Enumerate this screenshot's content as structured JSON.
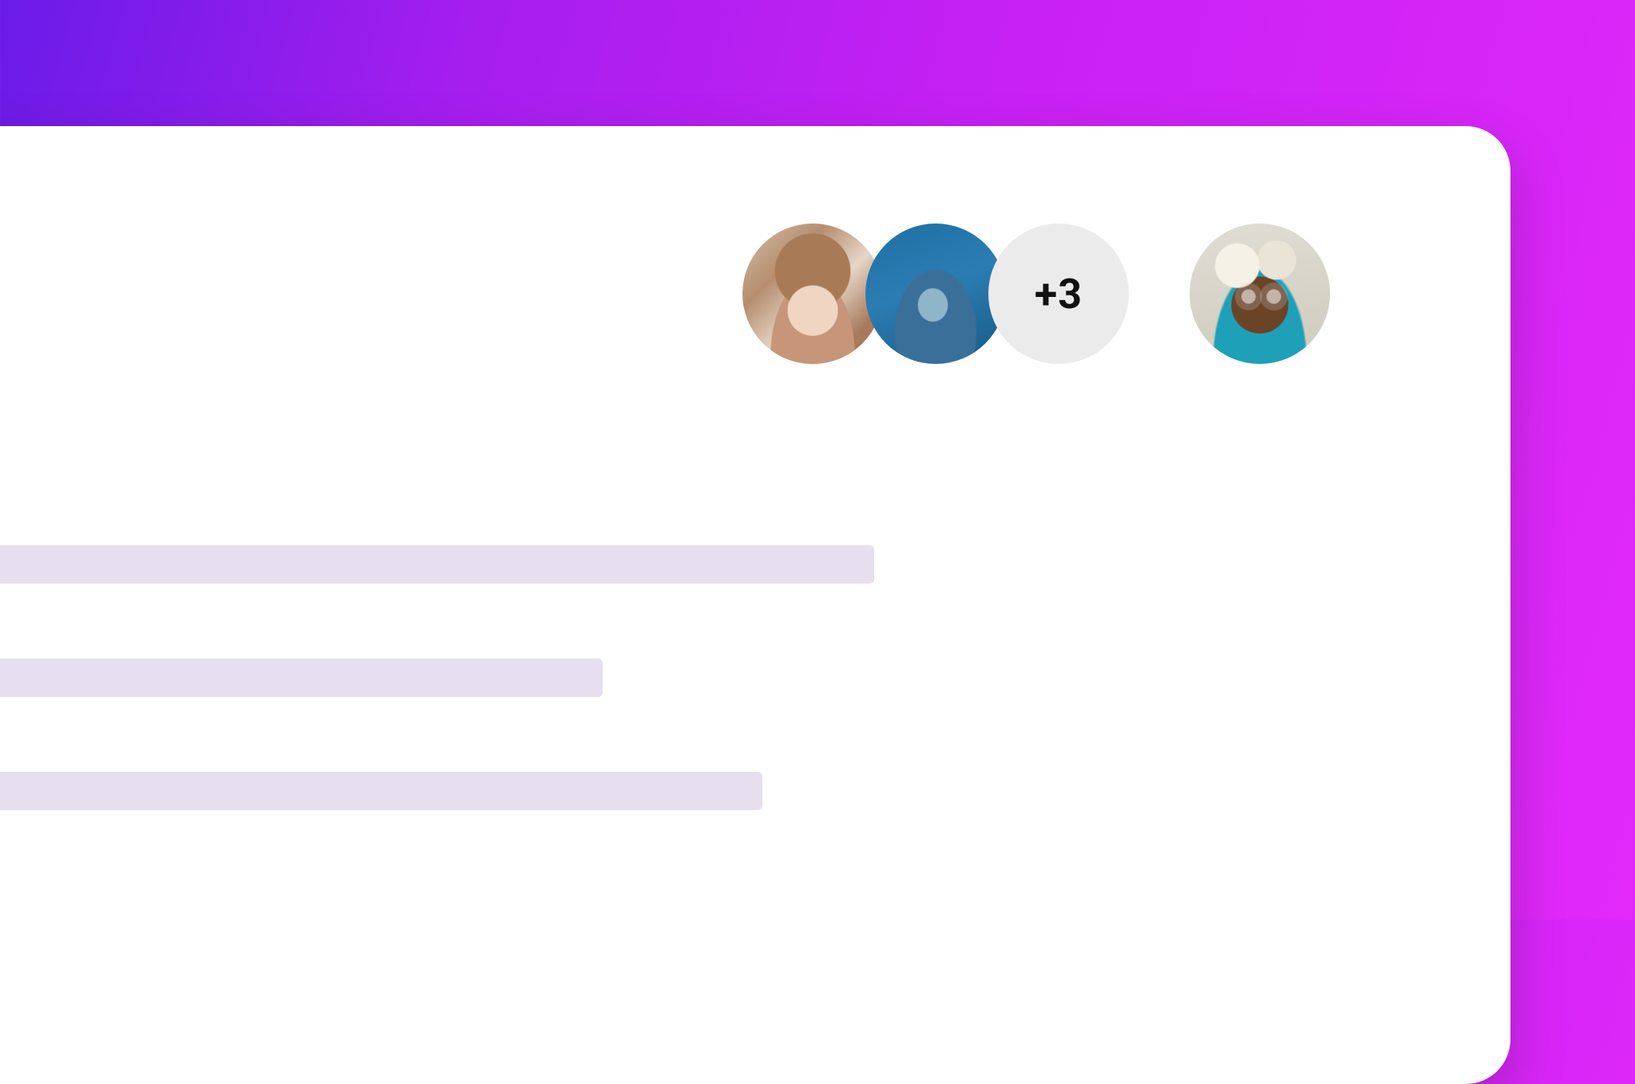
{
  "avatars": {
    "overflow_label": "+3"
  }
}
